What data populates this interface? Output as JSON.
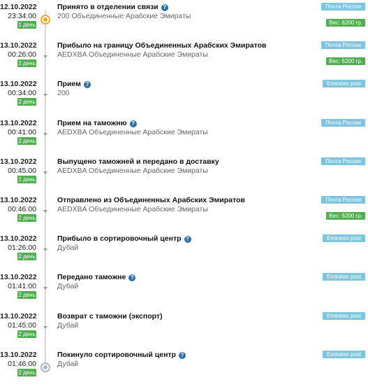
{
  "colors": {
    "days_badge": "#4fae4f",
    "carrier_badge": "#7ec4e0",
    "weight_badge": "#4fae4f",
    "help_icon": "#2f6ea6",
    "first_marker": "#f5a623"
  },
  "events": [
    {
      "date": "12.10.2022",
      "time": "23:34:00",
      "days": "1 день",
      "title": "Принято в отделении связи",
      "help": true,
      "location": "200 Объединенные Арабские Эмираты",
      "carrier": "Почта России",
      "weight": "Вес: 6200 гр.",
      "marker": "orange-dot-icon"
    },
    {
      "date": "13.10.2022",
      "time": "00:26:00",
      "days": "2 день",
      "title": "Прибыло на границу Объединенных Арабских Эмиратов",
      "help": false,
      "location": "AEDXBA Объединенные Арабские Эмираты",
      "carrier": "Почта России",
      "weight": "Вес: 6200 гр.",
      "marker": "chevron-down-icon"
    },
    {
      "date": "13.10.2022",
      "time": "00:34:00",
      "days": "2 день",
      "title": "Прием",
      "help": true,
      "location": "200",
      "carrier": "Emirates post",
      "weight": "",
      "marker": "chevron-down-icon"
    },
    {
      "date": "13.10.2022",
      "time": "00:41:00",
      "days": "2 день",
      "title": "Прием на таможню",
      "help": true,
      "location": "AEDXBA Объединенные Арабские Эмираты",
      "carrier": "Почта России",
      "weight": "",
      "marker": "chevron-down-icon"
    },
    {
      "date": "13.10.2022",
      "time": "00:45:00",
      "days": "2 день",
      "title": "Выпущено таможней и передано в доставку",
      "help": false,
      "location": "AEDXBA Объединенные Арабские Эмираты",
      "carrier": "Почта России",
      "weight": "",
      "marker": "chevron-down-icon"
    },
    {
      "date": "13.10.2022",
      "time": "00:46:00",
      "days": "2 день",
      "title": "Отправлено из Объединенных Арабских Эмиратов",
      "help": false,
      "location": "AEDXBA Объединенные Арабские Эмираты",
      "carrier": "Почта России",
      "weight": "Вес: 6200 гр.",
      "marker": "chevron-down-icon"
    },
    {
      "date": "13.10.2022",
      "time": "01:26:00",
      "days": "2 день",
      "title": "Прибыло в сортировочный центр",
      "help": true,
      "location": "Дубай",
      "carrier": "Emirates post",
      "weight": "",
      "marker": "chevron-down-icon"
    },
    {
      "date": "13.10.2022",
      "time": "01:41:00",
      "days": "2 день",
      "title": "Передано таможне",
      "help": true,
      "location": "Дубай",
      "carrier": "Emirates post",
      "weight": "",
      "marker": "chevron-down-icon"
    },
    {
      "date": "13.10.2022",
      "time": "01:45:00",
      "days": "2 день",
      "title": "Возврат с таможни (экспорт)",
      "help": false,
      "location": "Дубай",
      "carrier": "Emirates post",
      "weight": "",
      "marker": "chevron-down-icon"
    },
    {
      "date": "13.10.2022",
      "time": "01:46:00",
      "days": "2 день",
      "title": "Покинуло сортировочный центр",
      "help": true,
      "location": "Дубай",
      "carrier": "Emirates post",
      "weight": "",
      "marker": "grey-dot-icon"
    }
  ]
}
